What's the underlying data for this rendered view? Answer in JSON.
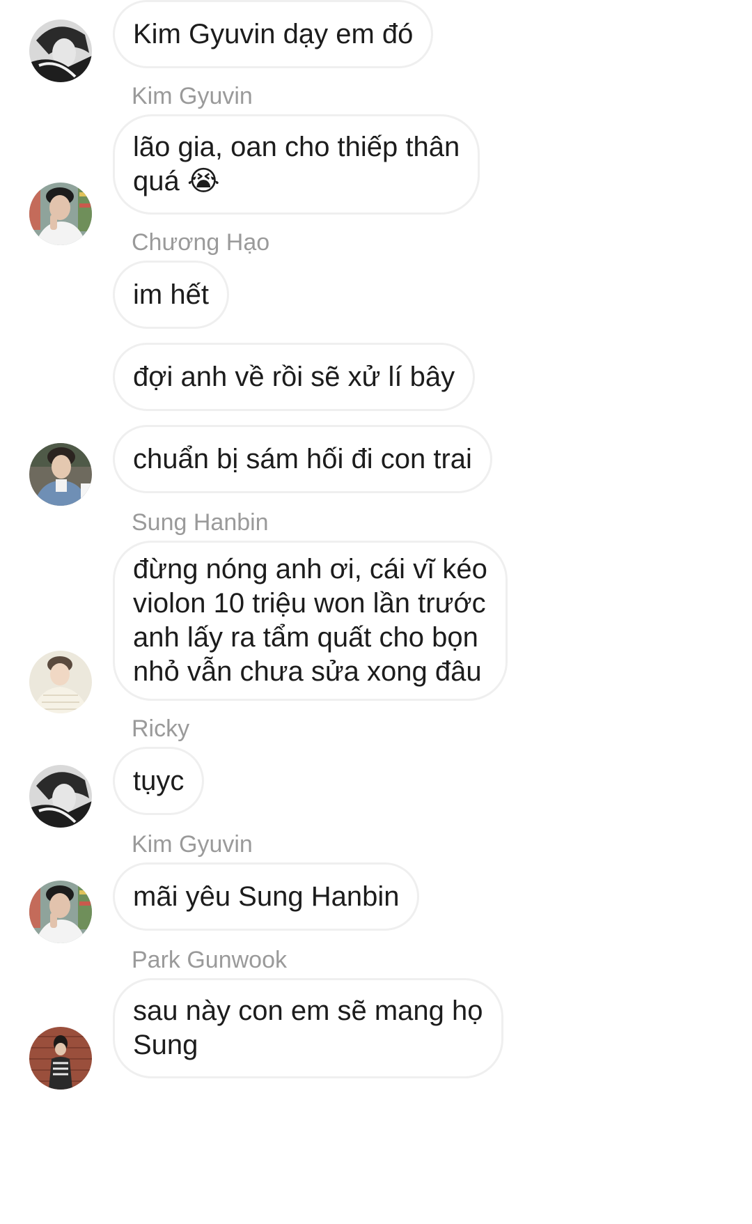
{
  "messages": [
    {
      "text": "Kim Gyuvin dạy em đó"
    },
    {
      "sender": "Kim Gyuvin",
      "text": "lão gia, oan cho thiếp thân\nquá 😭"
    },
    {
      "sender": "Chương Hạo",
      "text": "im hết"
    },
    {
      "text": "đợi anh về rồi sẽ xử lí bây"
    },
    {
      "text": "chuẩn bị sám hối đi con trai"
    },
    {
      "sender": "Sung Hanbin",
      "text": "đừng nóng anh ơi, cái vĩ kéo\nviolon 10 triệu won lần trước\nanh lấy ra tẩm quất cho bọn\nnhỏ vẫn chưa sửa xong đâu"
    },
    {
      "sender": "Ricky",
      "text": "tụyc"
    },
    {
      "sender": "Kim Gyuvin",
      "text": "mãi yêu Sung Hanbin"
    },
    {
      "sender": "Park Gunwook",
      "text": "sau này con em sẽ mang họ\nSung"
    }
  ],
  "avatars": [
    {
      "name": "monochrome-avatar-icon"
    },
    {
      "name": "store-photo-avatar-icon"
    },
    {
      "name": "denim-photo-avatar-icon"
    },
    {
      "name": "bright-photo-avatar-icon"
    },
    {
      "name": "monochrome-avatar-icon"
    },
    {
      "name": "store-photo-avatar-icon"
    },
    {
      "name": "brick-wall-avatar-icon"
    }
  ]
}
